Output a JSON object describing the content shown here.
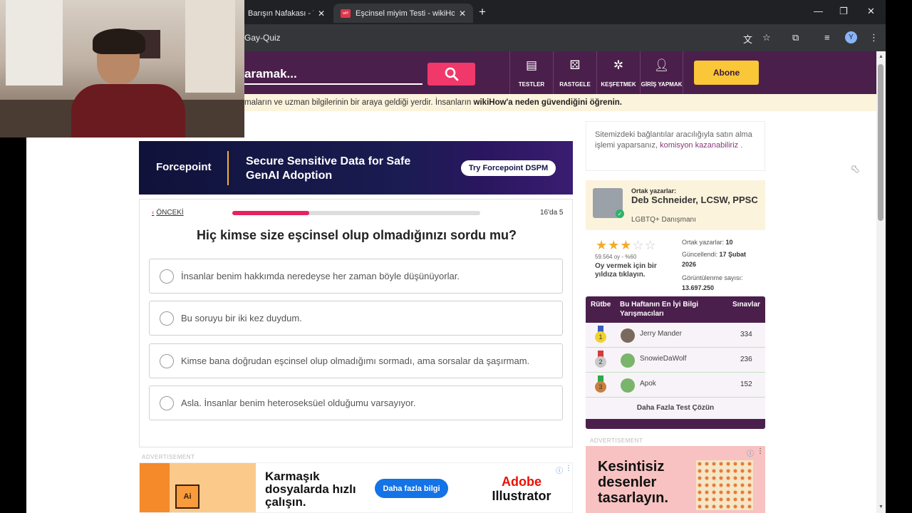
{
  "browser": {
    "tabs": [
      {
        "title": "Barışın Nafakası - Yo",
        "active": false
      },
      {
        "title": "Eşcinsel miyim Testi - wikiHow",
        "active": true
      }
    ],
    "favicon_text": "wH",
    "url": "Gay-Quiz",
    "profile_initial": "Y"
  },
  "header": {
    "search_placeholder": "aramak...",
    "nav": [
      {
        "label": "TESTLER",
        "icon": "quiz-icon"
      },
      {
        "label": "RASTGELE",
        "icon": "dice-icon"
      },
      {
        "label": "KEŞFETMEK",
        "icon": "compass-icon"
      },
      {
        "label": "GİRİŞ YAPMAK",
        "icon": "user-icon"
      }
    ],
    "subscribe_label": "Abone"
  },
  "trust_banner": {
    "text": "maların ve uzman bilgilerinin bir araya geldiği yerdir. İnsanların ",
    "bold": "wikiHow'a neden güvendiğini öğrenin."
  },
  "ad_top": {
    "brand": "Forcepoint",
    "headline": "Secure Sensitive Data for Safe GenAI Adoption",
    "cta": "Try Forcepoint DSPM"
  },
  "quiz": {
    "prev_label": "ÖNCEKİ",
    "progress_current": 5,
    "progress_total": 16,
    "progress_label": "16'da 5",
    "progress_fraction": 0.31,
    "question": "Hiç kimse size eşcinsel olup olmadığınızı sordu mu?",
    "options": [
      "İnsanlar benim hakkımda neredeyse her zaman böyle düşünüyorlar.",
      "Bu soruyu bir iki kez duydum.",
      "Kimse bana doğrudan eşcinsel olup olmadığımı sormadı, ama sorsalar da şaşırmam.",
      "Asla. İnsanlar benim heteroseksüel olduğumu varsayıyor."
    ]
  },
  "advertisement_label": "ADVERTISEMENT",
  "ad_bottom": {
    "text": "Karmaşık dosyalarda hızlı çalışın.",
    "cta": "Daha fazla bilgi",
    "brand_line1": "Adobe",
    "brand_line2": "Illustrator",
    "app_badge": "Ai"
  },
  "sidebar": {
    "affiliate_text": "Sitemizdeki bağlantılar aracılığıyla satın alma işlemi yaparsanız, ",
    "affiliate_link": "komisyon kazanabiliriz",
    "affiliate_end": " .",
    "author": {
      "role": "Ortak yazarlar:",
      "name": "Deb Schneider, LCSW, PPSC",
      "title": "LGBTQ+ Danışmanı"
    },
    "rating": {
      "stars": 3,
      "max": 5,
      "count_text": "59.564 oy - %60",
      "vote_prompt": "Oy vermek için bir yıldıza tıklayın."
    },
    "stats": {
      "coauthors_label": "Ortak yazarlar: ",
      "coauthors": "10",
      "updated_label": "Güncellendi: ",
      "updated": "17 Şubat 2026",
      "views_label": "Görüntülenme sayısı: ",
      "views": "13.697.250"
    },
    "leaderboard": {
      "col_rank": "Rütbe",
      "col_title": "Bu Haftanın En İyi Bilgi Yarışmacıları",
      "col_quizzes": "Sınavlar",
      "rows": [
        {
          "rank": "1",
          "name": "Jerry Mander",
          "score": "334"
        },
        {
          "rank": "2",
          "name": "SnowieDaWolf",
          "score": "236"
        },
        {
          "rank": "3",
          "name": "Apok",
          "score": "152"
        }
      ],
      "more": "Daha Fazla Test Çözün"
    },
    "ad_right": {
      "text": "Kesintisiz desenler tasarlayın."
    }
  }
}
